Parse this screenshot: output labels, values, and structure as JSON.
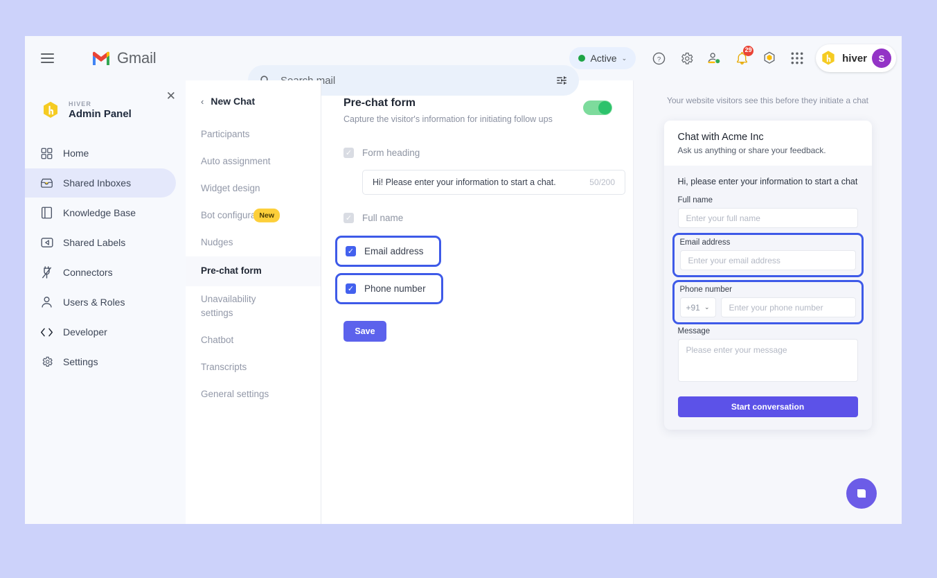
{
  "gmail_bar": {
    "hamburger_icon": "hamburger-menu-icon",
    "logo_text": "Gmail",
    "search": {
      "icon": "search-icon",
      "placeholder": "Search mail",
      "filter_icon": "search-options-icon"
    },
    "status": {
      "label": "Active",
      "dot_color": "#1ea446",
      "caret": "⌄"
    },
    "icons": [
      "help-icon",
      "settings-gear-icon",
      "add-contact-icon",
      "notifications-bell-icon",
      "hiver-hex-icon",
      "google-apps-grid-icon"
    ],
    "notification_count": "29",
    "account_chip": {
      "brand": "hiver",
      "avatar_initial": "S",
      "avatar_color": "#9334c6"
    }
  },
  "sidebar": {
    "close_icon": "close-icon",
    "brand": {
      "eyebrow": "HIVER",
      "title": "Admin Panel",
      "logo_icon": "hiver-hex-logo-icon",
      "logo_color": "#f5cb22"
    },
    "items": [
      {
        "label": "Home",
        "icon": "grid-home-icon",
        "active": false
      },
      {
        "label": "Shared Inboxes",
        "icon": "inbox-icon",
        "active": true
      },
      {
        "label": "Knowledge Base",
        "icon": "book-icon",
        "active": false
      },
      {
        "label": "Shared Labels",
        "icon": "label-tag-icon",
        "active": false
      },
      {
        "label": "Connectors",
        "icon": "plug-connector-icon",
        "active": false
      },
      {
        "label": "Users & Roles",
        "icon": "person-icon",
        "active": false
      },
      {
        "label": "Developer",
        "icon": "code-brackets-icon",
        "active": false
      },
      {
        "label": "Settings",
        "icon": "gear-icon",
        "active": false
      }
    ]
  },
  "subnav": {
    "back_icon": "chevron-left-icon",
    "title": "New Chat",
    "items": [
      {
        "label": "Participants",
        "selected": false,
        "badge": ""
      },
      {
        "label": "Auto assignment",
        "selected": false,
        "badge": ""
      },
      {
        "label": "Widget design",
        "selected": false,
        "badge": ""
      },
      {
        "label": "Bot configuration",
        "selected": false,
        "badge": "New"
      },
      {
        "label": "Nudges",
        "selected": false,
        "badge": ""
      },
      {
        "label": "Pre-chat form",
        "selected": true,
        "badge": ""
      },
      {
        "label": "Unavailability settings",
        "selected": false,
        "badge": ""
      },
      {
        "label": "Chatbot",
        "selected": false,
        "badge": ""
      },
      {
        "label": "Transcripts",
        "selected": false,
        "badge": ""
      },
      {
        "label": "General settings",
        "selected": false,
        "badge": ""
      }
    ]
  },
  "main": {
    "title": "Pre-chat form",
    "subtitle": "Capture the visitor's information for initiating follow ups",
    "toggle_on": true,
    "form_heading": {
      "label": "Form heading",
      "checked": true,
      "locked": true,
      "value": "Hi! Please enter your information to start a chat.",
      "counter": "50/200"
    },
    "full_name": {
      "label": "Full name",
      "checked": true,
      "locked": true
    },
    "email_address": {
      "label": "Email address",
      "checked": true,
      "highlighted": true
    },
    "phone_number": {
      "label": "Phone number",
      "checked": true,
      "highlighted": true
    },
    "save_label": "Save"
  },
  "preview": {
    "caption": "Your website visitors see this before they initiate a chat",
    "card_title": "Chat with Acme Inc",
    "card_subtitle": "Ask us anything or share your feedback.",
    "greeting": "Hi, please enter your information to start a chat",
    "fields": {
      "full_name": {
        "label": "Full name",
        "placeholder": "Enter your full name"
      },
      "email": {
        "label": "Email address",
        "placeholder": "Enter your email address"
      },
      "phone": {
        "label": "Phone number",
        "country_code": "+91",
        "placeholder": "Enter your phone number"
      },
      "message": {
        "label": "Message",
        "placeholder": "Please enter your message"
      }
    },
    "start_button": "Start conversation",
    "fab_icon": "chat-bubble-icon"
  },
  "colors": {
    "highlight": "#3e5ae8",
    "accent": "#5c62ec",
    "toggle_green": "#2cc26b",
    "badge_yellow": "#fdcf3a",
    "page_bg": "#ccd2fa"
  }
}
